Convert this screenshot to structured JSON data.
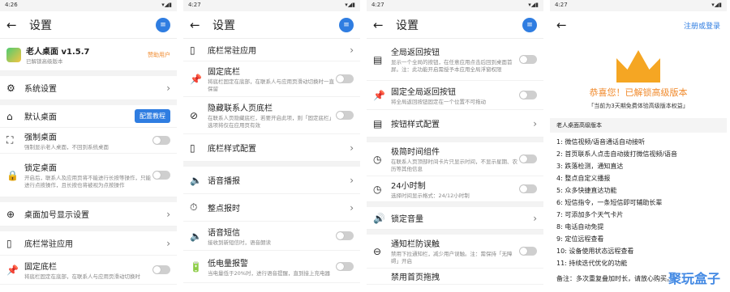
{
  "screen1": {
    "time": "4:26",
    "title": "设置",
    "app_name": "老人桌面 v1.5.7",
    "app_status": "已解锁高级版本",
    "user_badge": "赞助用户",
    "rows": [
      {
        "label": "系统设置",
        "icon": "gear-icon",
        "type": "chev"
      },
      {
        "label": "默认桌面",
        "icon": "home-icon",
        "type": "button",
        "button": "配置教程"
      },
      {
        "label": "强制桌面",
        "sub": "强制显示老人桌面，不回到系统桌面",
        "icon": "force-icon",
        "type": "toggle"
      },
      {
        "label": "锁定桌面",
        "sub": "开启后，联系人及应用页将不能进行长按等操作，只能进行点按操作，且长按也将被视为点按操作",
        "icon": "lock-icon",
        "type": "toggle"
      },
      {
        "label": "桌面加号显示设置",
        "icon": "plus-icon",
        "type": "chev"
      },
      {
        "label": "底栏常驻应用",
        "icon": "phone-icon",
        "type": "chev"
      },
      {
        "label": "固定底栏",
        "sub": "将底栏固定在底部，在联系人与应用页滑动切换时",
        "icon": "pin-icon",
        "type": "toggle"
      }
    ]
  },
  "screen2": {
    "time": "4:27",
    "title": "设置",
    "rows": [
      {
        "label": "底栏常驻应用",
        "icon": "phone-icon",
        "type": "chev"
      },
      {
        "label": "固定底栏",
        "sub": "将底栏固定在底部，在联系人与应用页滑动切换时一直保留",
        "icon": "pin-icon",
        "type": "toggle"
      },
      {
        "label": "隐藏联系人页底栏",
        "sub": "在联系人页隐藏底栏，若要开启此项，则「固定底栏」选项将仅在应用页有效",
        "icon": "eye-off-icon",
        "type": "toggle"
      },
      {
        "label": "底栏样式配置",
        "icon": "phone-icon",
        "type": "chev"
      },
      {
        "label": "语音播报",
        "icon": "speaker-icon",
        "type": "chev"
      },
      {
        "label": "整点报时",
        "icon": "timer-icon",
        "type": "chev"
      },
      {
        "label": "语音短信",
        "sub": "接收到新短信时，语音朗读",
        "icon": "speaker-icon",
        "type": "toggle"
      },
      {
        "label": "低电量报警",
        "sub": "当电量低于20%时，进行语音提醒，直到接上充电器",
        "icon": "battery-icon",
        "type": "toggle"
      }
    ]
  },
  "screen3": {
    "time": "4:27",
    "title": "设置",
    "rows": [
      {
        "label": "全局返回按钮",
        "sub": "显示一个全局的按钮，在任意应用点击后回到桌面首屏。注：此功能开启需授予本应用全局浮窗权限",
        "icon": "store-icon",
        "type": "toggle"
      },
      {
        "label": "固定全局返回按钮",
        "sub": "将全局返回按钮固定在一个位置不可拖动",
        "icon": "pin-icon",
        "type": "toggle"
      },
      {
        "label": "按钮样式配置",
        "icon": "store-icon",
        "type": "chev"
      },
      {
        "label": "极简时间组件",
        "sub": "在联系人页顶部时间卡片只显示时间，不显示星期、农历等其他信息",
        "icon": "clock-icon",
        "type": "toggle"
      },
      {
        "label": "24小时制",
        "sub": "选择时间显示格式：24/12小时制",
        "icon": "clock-icon",
        "type": "toggle"
      },
      {
        "label": "锁定音量",
        "icon": "volume-icon",
        "type": "chev"
      },
      {
        "label": "通知栏防误触",
        "sub": "禁用下拉通知栏，减少用户误触。注：需保持「无障碍」开启",
        "icon": "block-icon",
        "type": "toggle"
      },
      {
        "label": "禁用首页拖拽",
        "icon": "drag-icon",
        "type": "none"
      }
    ]
  },
  "screen4": {
    "time": "4:27",
    "login": "注册或登录",
    "congrats": "恭喜您！已解锁高级版本",
    "trial": "「当前为3天期免费体验高级版本权益」",
    "version_header": "老人桌面高级版本",
    "features": [
      "1:  微信视频/语音通话自动接听",
      "2:  首页联系人点击自动拨打微信视频/语音",
      "3:  跌落检测，通知直达",
      "4:  整点自定义播报",
      "5:  众多快捷直达功能",
      "6:  短信指令，一条短信即可辅助长辈",
      "7:  可添加多个天气卡片",
      "8:  电话自动免提",
      "9:  定位远程查看",
      "10:  设备使用状态远程查看",
      "11:  持续迭代优化的功能"
    ],
    "note": "备注：多次重复叠加时长，请放心购买。",
    "watermark": "聚玩盒子"
  }
}
